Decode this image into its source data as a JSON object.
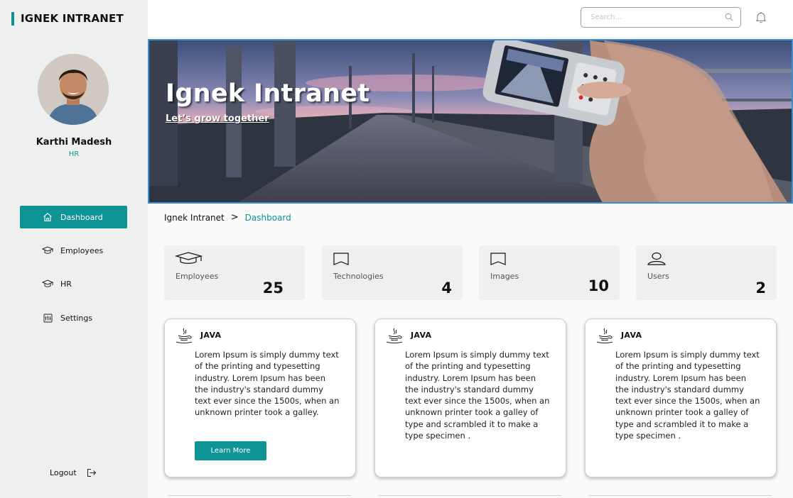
{
  "app": {
    "brand": "IGNEK INTRANET"
  },
  "user": {
    "name": "Karthi Madesh",
    "role": "HR"
  },
  "nav": [
    {
      "label": "Dashboard",
      "icon": "home-icon",
      "active": true
    },
    {
      "label": "Employees",
      "icon": "graduation-cap-icon",
      "active": false
    },
    {
      "label": "HR",
      "icon": "graduation-cap-icon",
      "active": false
    },
    {
      "label": "Settings",
      "icon": "settings-icon",
      "active": false
    }
  ],
  "logout": {
    "label": "Logout",
    "icon": "logout-icon"
  },
  "search": {
    "placeholder": "Search...",
    "value": ""
  },
  "hero": {
    "title": "Ignek Intranet",
    "subtitle": "Let’s grow together"
  },
  "breadcrumb": {
    "root": "Ignek Intranet",
    "separator": ">",
    "current": "Dashboard"
  },
  "stats": [
    {
      "label": "Employees",
      "value": "25",
      "icon": "graduation-cap-icon"
    },
    {
      "label": "Technologies",
      "value": "4",
      "icon": "book-icon"
    },
    {
      "label": "Images",
      "value": "10",
      "icon": "book-icon"
    },
    {
      "label": "Users",
      "value": "2",
      "icon": "user-icon"
    }
  ],
  "cards": [
    {
      "title": "JAVA",
      "icon": "java-icon",
      "description": "Lorem Ipsum is simply dummy text of the printing and typesetting industry. Lorem Ipsum has been the industry's standard dummy text ever since the 1500s, when an unknown printer took a galley.",
      "button": "Learn More"
    },
    {
      "title": "JAVA",
      "icon": "java-icon",
      "description": "Lorem Ipsum is simply dummy text of the printing and typesetting industry. Lorem Ipsum has been the industry's standard dummy text ever since the 1500s, when an unknown printer took a galley of type and scrambled it to make a type specimen ."
    },
    {
      "title": "JAVA",
      "icon": "java-icon",
      "description": "Lorem Ipsum is simply dummy text of the printing and typesetting industry. Lorem Ipsum has been the industry's standard dummy text ever since the 1500s, when an unknown printer took a galley of type and scrambled it to make a type specimen ."
    }
  ],
  "colors": {
    "accent": "#0e9494",
    "sidebar": "#eef0ef",
    "card": "#efefef",
    "hero_border": "#3b8fd3"
  }
}
